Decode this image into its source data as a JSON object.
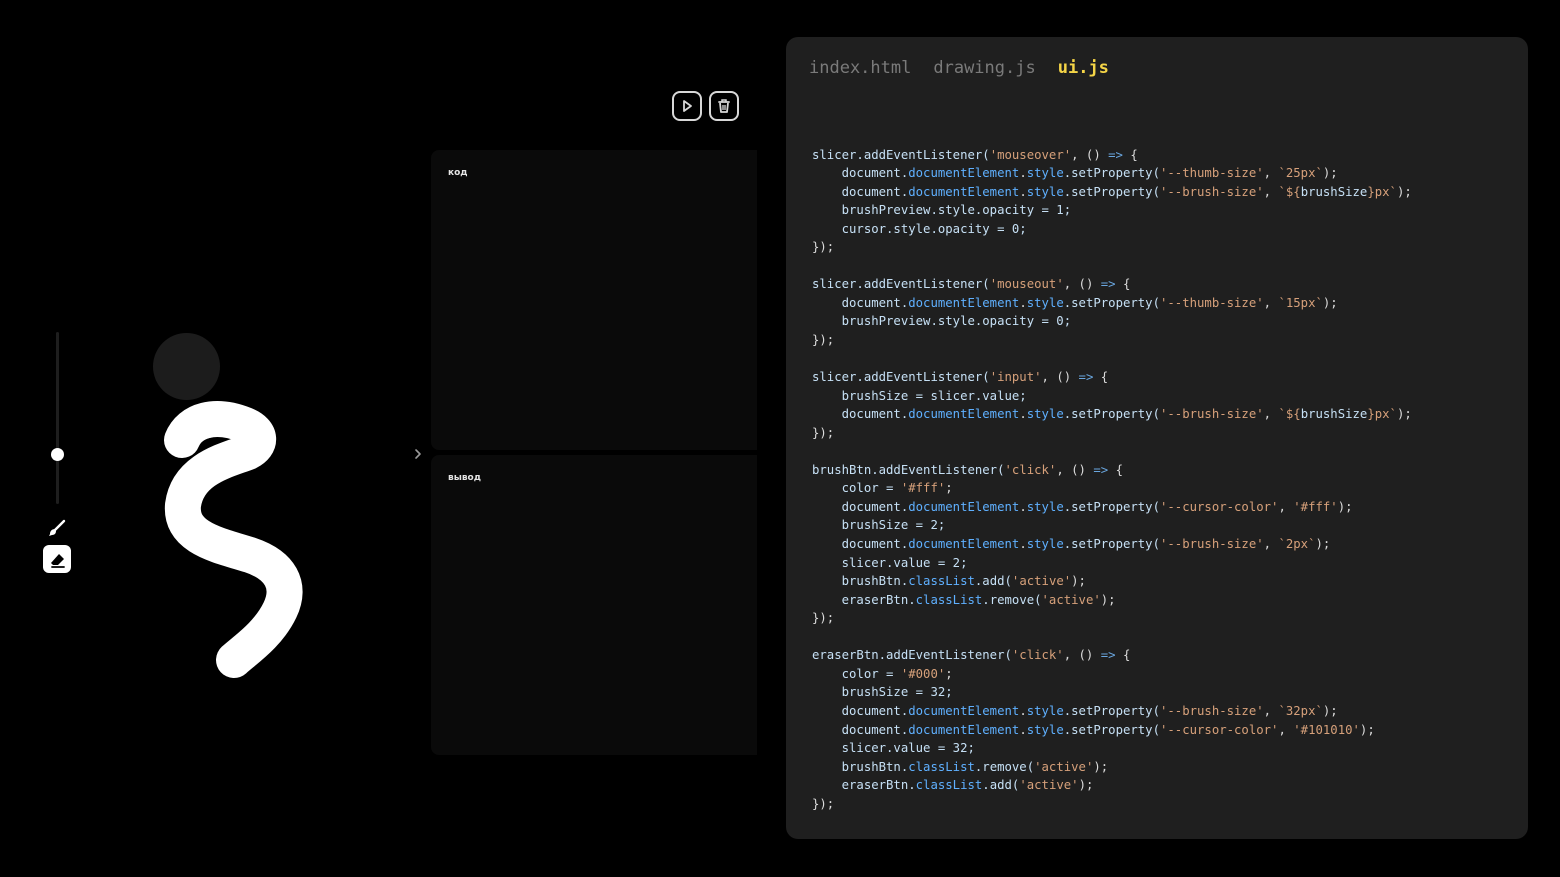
{
  "toolbar": {
    "run_icon": "play-icon",
    "delete_icon": "trash-icon"
  },
  "drawing": {
    "brush_size_slider_level": 0.25,
    "brush_icon": "brush-icon",
    "eraser_icon": "eraser-icon",
    "stroke_color": "#ffffff",
    "canvas_color": "#000000"
  },
  "panels": {
    "code_label": "код",
    "output_label": "вывод",
    "collapse_icon": "chevron-right-icon"
  },
  "editor": {
    "tabs": [
      {
        "label": "index.html",
        "active": false
      },
      {
        "label": "drawing.js",
        "active": false
      },
      {
        "label": "ui.js",
        "active": true
      }
    ],
    "active_tab_color": "#f5d547",
    "lines": [
      [],
      [
        [
          "slicer.addEventListener(",
          "var"
        ],
        [
          "'mouseover'",
          "str"
        ],
        [
          ", () ",
          "plain"
        ],
        [
          "=>",
          "kw"
        ],
        [
          " {",
          "plain"
        ]
      ],
      [
        [
          "    document.",
          "var"
        ],
        [
          "documentElement",
          "prop"
        ],
        [
          ".",
          "plain"
        ],
        [
          "style",
          "prop"
        ],
        [
          ".setProperty(",
          "var"
        ],
        [
          "'--thumb-size'",
          "str"
        ],
        [
          ", ",
          "plain"
        ],
        [
          "`25px`",
          "str"
        ],
        [
          ");",
          "plain"
        ]
      ],
      [
        [
          "    document.",
          "var"
        ],
        [
          "documentElement",
          "prop"
        ],
        [
          ".",
          "plain"
        ],
        [
          "style",
          "prop"
        ],
        [
          ".setProperty(",
          "var"
        ],
        [
          "'--brush-size'",
          "str"
        ],
        [
          ", ",
          "plain"
        ],
        [
          "`${",
          "str"
        ],
        [
          "brushSize",
          "var"
        ],
        [
          "}px`",
          "str"
        ],
        [
          ");",
          "plain"
        ]
      ],
      [
        [
          "    brushPreview.style.opacity = 1;",
          "var"
        ]
      ],
      [
        [
          "    cursor.style.opacity = 0;",
          "var"
        ]
      ],
      [
        [
          "});",
          "plain"
        ]
      ],
      [],
      [
        [
          "slicer.addEventListener(",
          "var"
        ],
        [
          "'mouseout'",
          "str"
        ],
        [
          ", () ",
          "plain"
        ],
        [
          "=>",
          "kw"
        ],
        [
          " {",
          "plain"
        ]
      ],
      [
        [
          "    document.",
          "var"
        ],
        [
          "documentElement",
          "prop"
        ],
        [
          ".",
          "plain"
        ],
        [
          "style",
          "prop"
        ],
        [
          ".setProperty(",
          "var"
        ],
        [
          "'--thumb-size'",
          "str"
        ],
        [
          ", ",
          "plain"
        ],
        [
          "`15px`",
          "str"
        ],
        [
          ");",
          "plain"
        ]
      ],
      [
        [
          "    brushPreview.style.opacity = 0;",
          "var"
        ]
      ],
      [
        [
          "});",
          "plain"
        ]
      ],
      [],
      [
        [
          "slicer.addEventListener(",
          "var"
        ],
        [
          "'input'",
          "str"
        ],
        [
          ", () ",
          "plain"
        ],
        [
          "=>",
          "kw"
        ],
        [
          " {",
          "plain"
        ]
      ],
      [
        [
          "    brushSize = slicer.value;",
          "var"
        ]
      ],
      [
        [
          "    document.",
          "var"
        ],
        [
          "documentElement",
          "prop"
        ],
        [
          ".",
          "plain"
        ],
        [
          "style",
          "prop"
        ],
        [
          ".setProperty(",
          "var"
        ],
        [
          "'--brush-size'",
          "str"
        ],
        [
          ", ",
          "plain"
        ],
        [
          "`${",
          "str"
        ],
        [
          "brushSize",
          "var"
        ],
        [
          "}px`",
          "str"
        ],
        [
          ");",
          "plain"
        ]
      ],
      [
        [
          "});",
          "plain"
        ]
      ],
      [],
      [
        [
          "brushBtn.addEventListener(",
          "var"
        ],
        [
          "'click'",
          "str"
        ],
        [
          ", () ",
          "plain"
        ],
        [
          "=>",
          "kw"
        ],
        [
          " {",
          "plain"
        ]
      ],
      [
        [
          "    color = ",
          "var"
        ],
        [
          "'#fff'",
          "str"
        ],
        [
          ";",
          "plain"
        ]
      ],
      [
        [
          "    document.",
          "var"
        ],
        [
          "documentElement",
          "prop"
        ],
        [
          ".",
          "plain"
        ],
        [
          "style",
          "prop"
        ],
        [
          ".setProperty(",
          "var"
        ],
        [
          "'--cursor-color'",
          "str"
        ],
        [
          ", ",
          "plain"
        ],
        [
          "'#fff'",
          "str"
        ],
        [
          ");",
          "plain"
        ]
      ],
      [
        [
          "    brushSize = 2;",
          "var"
        ]
      ],
      [
        [
          "    document.",
          "var"
        ],
        [
          "documentElement",
          "prop"
        ],
        [
          ".",
          "plain"
        ],
        [
          "style",
          "prop"
        ],
        [
          ".setProperty(",
          "var"
        ],
        [
          "'--brush-size'",
          "str"
        ],
        [
          ", ",
          "plain"
        ],
        [
          "`2px`",
          "str"
        ],
        [
          ");",
          "plain"
        ]
      ],
      [
        [
          "    slicer.value = 2;",
          "var"
        ]
      ],
      [
        [
          "    brushBtn.",
          "var"
        ],
        [
          "classList",
          "prop"
        ],
        [
          ".add(",
          "var"
        ],
        [
          "'active'",
          "str"
        ],
        [
          ");",
          "plain"
        ]
      ],
      [
        [
          "    eraserBtn.",
          "var"
        ],
        [
          "classList",
          "prop"
        ],
        [
          ".remove(",
          "var"
        ],
        [
          "'active'",
          "str"
        ],
        [
          ");",
          "plain"
        ]
      ],
      [
        [
          "});",
          "plain"
        ]
      ],
      [],
      [
        [
          "eraserBtn.addEventListener(",
          "var"
        ],
        [
          "'click'",
          "str"
        ],
        [
          ", () ",
          "plain"
        ],
        [
          "=>",
          "kw"
        ],
        [
          " {",
          "plain"
        ]
      ],
      [
        [
          "    color = ",
          "var"
        ],
        [
          "'#000'",
          "str"
        ],
        [
          ";",
          "plain"
        ]
      ],
      [
        [
          "    brushSize = 32;",
          "var"
        ]
      ],
      [
        [
          "    document.",
          "var"
        ],
        [
          "documentElement",
          "prop"
        ],
        [
          ".",
          "plain"
        ],
        [
          "style",
          "prop"
        ],
        [
          ".setProperty(",
          "var"
        ],
        [
          "'--brush-size'",
          "str"
        ],
        [
          ", ",
          "plain"
        ],
        [
          "`32px`",
          "str"
        ],
        [
          ");",
          "plain"
        ]
      ],
      [
        [
          "    document.",
          "var"
        ],
        [
          "documentElement",
          "prop"
        ],
        [
          ".",
          "plain"
        ],
        [
          "style",
          "prop"
        ],
        [
          ".setProperty(",
          "var"
        ],
        [
          "'--cursor-color'",
          "str"
        ],
        [
          ", ",
          "plain"
        ],
        [
          "'#101010'",
          "str"
        ],
        [
          ");",
          "plain"
        ]
      ],
      [
        [
          "    slicer.value = 32;",
          "var"
        ]
      ],
      [
        [
          "    brushBtn.",
          "var"
        ],
        [
          "classList",
          "prop"
        ],
        [
          ".remove(",
          "var"
        ],
        [
          "'active'",
          "str"
        ],
        [
          ");",
          "plain"
        ]
      ],
      [
        [
          "    eraserBtn.",
          "var"
        ],
        [
          "classList",
          "prop"
        ],
        [
          ".add(",
          "var"
        ],
        [
          "'active'",
          "str"
        ],
        [
          ");",
          "plain"
        ]
      ],
      [
        [
          "});",
          "plain"
        ]
      ]
    ]
  }
}
